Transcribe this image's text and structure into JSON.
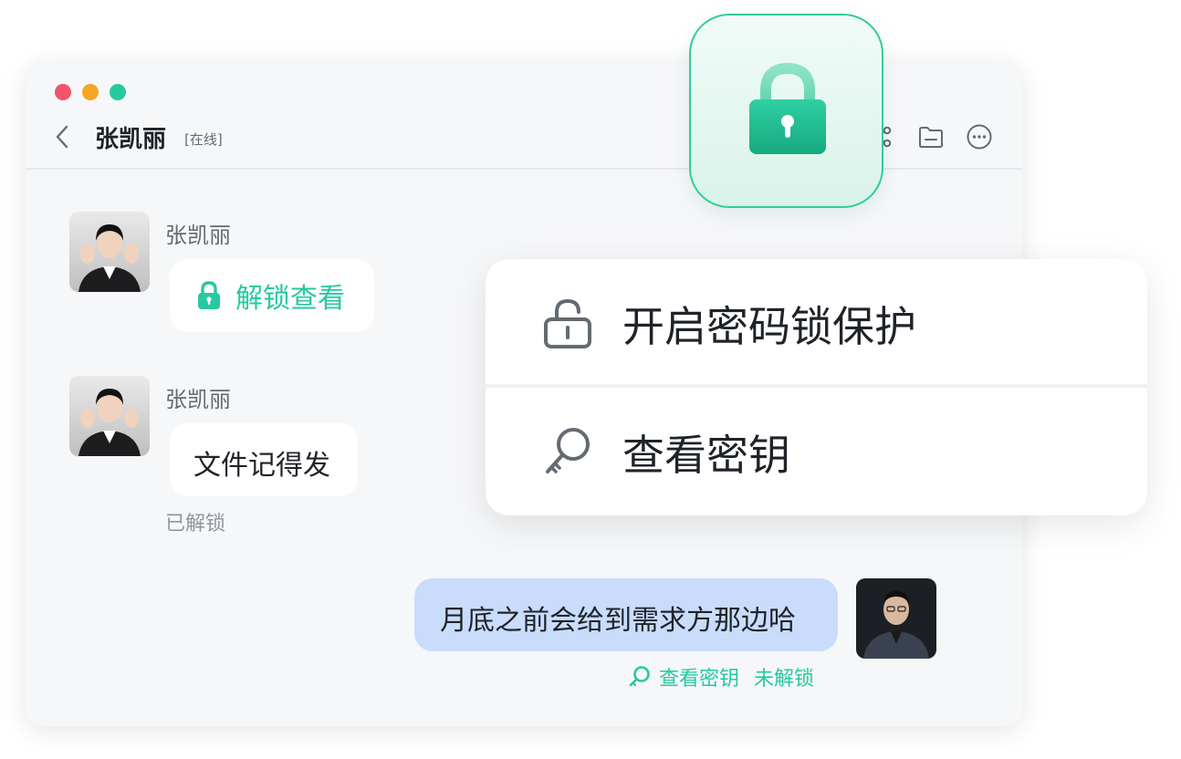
{
  "header": {
    "contact_name": "张凯丽",
    "status": "[在线]"
  },
  "messages": [
    {
      "sender": "张凯丽",
      "content": "解锁查看",
      "type": "locked",
      "icon": "lock-icon"
    },
    {
      "sender": "张凯丽",
      "content": "文件记得发",
      "status": "已解锁"
    },
    {
      "content": "月底之前会给到需求方那边哈",
      "outgoing": true,
      "view_key_label": "查看密钥",
      "lock_status": "未解锁"
    }
  ],
  "menu": {
    "items": [
      {
        "label": "开启密码锁保护",
        "icon": "unlock-icon"
      },
      {
        "label": "查看密钥",
        "icon": "key-icon"
      }
    ]
  },
  "colors": {
    "accent": "#26c9a0",
    "outgoing_bubble": "#c9dcfb",
    "window_bg": "#f6f7f9"
  }
}
